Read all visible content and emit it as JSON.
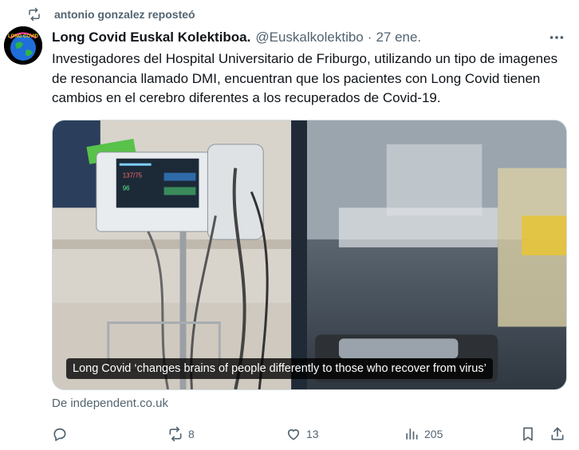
{
  "repost": {
    "label": "antonio gonzalez reposteó",
    "icon": "repost-icon"
  },
  "author": {
    "avatar_text": "LONG COVID",
    "name": "Long Covid Euskal Kolektiboa.",
    "handle": "@Euskalkolektibo",
    "separator": "·",
    "date": "27 ene."
  },
  "tweet": {
    "text": "Investigadores del Hospital Universitario de Friburgo, utilizando un tipo de imagenes de resonancia llamado DMI, encuentran que los pacientes con Long Covid tienen cambios en el cerebro diferentes a los recuperados de Covid-19."
  },
  "card": {
    "caption": "Long Covid ‘changes brains of people differently to those who recover from virus’",
    "source": "De independent.co.uk",
    "monitor_values": [
      "137/75",
      "96"
    ]
  },
  "actions": {
    "reply": {
      "icon": "reply-icon",
      "count": ""
    },
    "retweet": {
      "icon": "retweet-icon",
      "count": "8"
    },
    "like": {
      "icon": "heart-icon",
      "count": "13"
    },
    "views": {
      "icon": "views-icon",
      "count": "205"
    },
    "bookmark": {
      "icon": "bookmark-icon"
    },
    "share": {
      "icon": "share-icon"
    }
  },
  "colors": {
    "text": "#0f1419",
    "secondary": "#536471",
    "border": "#cfd9de"
  }
}
